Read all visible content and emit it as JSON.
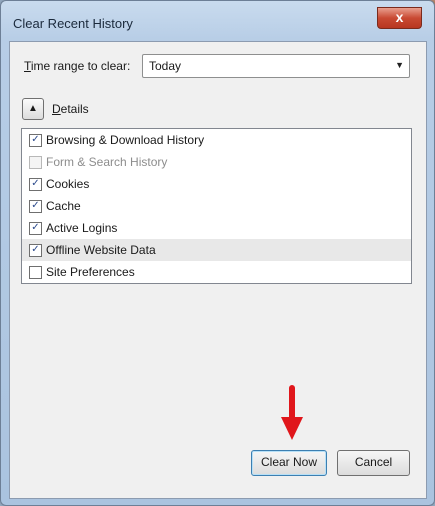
{
  "dialog": {
    "title": "Clear Recent History",
    "close_glyph": "x"
  },
  "time_range": {
    "label_first": "T",
    "label_rest": "ime range to clear:",
    "selected": "Today"
  },
  "details": {
    "toggle_glyph": "▲",
    "label_first": "D",
    "label_rest": "etails"
  },
  "items": [
    {
      "label": "Browsing & Download History",
      "checked": true,
      "disabled": false,
      "highlighted": false
    },
    {
      "label": "Form & Search History",
      "checked": false,
      "disabled": true,
      "highlighted": false
    },
    {
      "label": "Cookies",
      "checked": true,
      "disabled": false,
      "highlighted": false
    },
    {
      "label": "Cache",
      "checked": true,
      "disabled": false,
      "highlighted": false
    },
    {
      "label": "Active Logins",
      "checked": true,
      "disabled": false,
      "highlighted": false
    },
    {
      "label": "Offline Website Data",
      "checked": true,
      "disabled": false,
      "highlighted": true
    },
    {
      "label": "Site Preferences",
      "checked": false,
      "disabled": false,
      "highlighted": false
    }
  ],
  "buttons": {
    "clear_now": "Clear Now",
    "cancel": "Cancel"
  },
  "colors": {
    "annotation_arrow": "#e0161b",
    "checkmark": "#2b4a8c"
  }
}
